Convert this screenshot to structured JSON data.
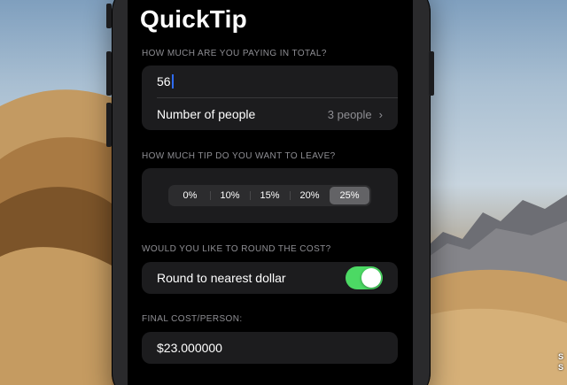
{
  "app": {
    "title": "QuickTip"
  },
  "total": {
    "header": "HOW MUCH ARE YOU PAYING IN TOTAL?",
    "amount_value": "56",
    "people_label": "Number of people",
    "people_value": "3 people",
    "chevron": "›"
  },
  "tip": {
    "header": "HOW MUCH TIP DO YOU WANT TO LEAVE?",
    "options": [
      "0%",
      "10%",
      "15%",
      "20%",
      "25%"
    ],
    "selected": "25%"
  },
  "rounding": {
    "header": "WOULD YOU LIKE TO ROUND THE COST?",
    "label": "Round to nearest dollar",
    "enabled": true,
    "toggle_color": "#4cd964"
  },
  "result": {
    "header": "FINAL COST/PERSON:",
    "value": "$23.000000"
  },
  "desktop": {
    "corner_lines": [
      "S",
      "S"
    ]
  },
  "colors": {
    "background": "#000000",
    "card": "#1c1c1e",
    "secondary_text": "#8e8e93",
    "selected_segment": "#636366",
    "caret": "#2f6cf4"
  }
}
